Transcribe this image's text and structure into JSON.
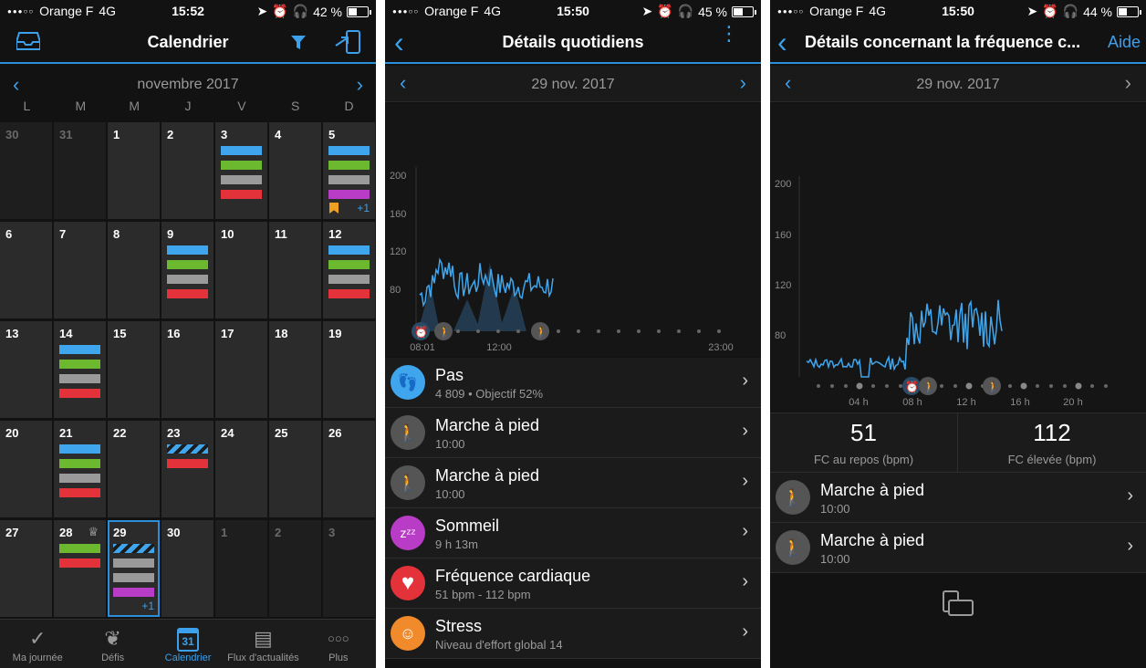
{
  "colors": {
    "blue": "#3fa6ee",
    "green": "#6cb82e",
    "gray": "#9a9a9a",
    "red": "#e4323a",
    "purple": "#b83cc6",
    "accent": "#2a8fd8"
  },
  "screen1": {
    "status": {
      "carrier": "Orange F",
      "network": "4G",
      "time": "15:52",
      "battery": "42 %",
      "battery_level": 0.42
    },
    "nav": {
      "title": "Calendrier",
      "left_icon": "inbox-icon",
      "filter_icon": "filter-icon",
      "export_icon": "export-icon"
    },
    "month": "novembre 2017",
    "weekdays": [
      "L",
      "M",
      "M",
      "J",
      "V",
      "S",
      "D"
    ],
    "days": [
      {
        "n": "30",
        "dim": true,
        "bars": []
      },
      {
        "n": "31",
        "dim": true,
        "bars": []
      },
      {
        "n": "1",
        "bars": []
      },
      {
        "n": "2",
        "bars": []
      },
      {
        "n": "3",
        "bars": [
          "blue",
          "green",
          "gray",
          "red"
        ]
      },
      {
        "n": "4",
        "bars": []
      },
      {
        "n": "5",
        "bars": [
          "blue",
          "green",
          "gray",
          "purple"
        ],
        "flag": true,
        "plus": "+1"
      },
      {
        "n": "6",
        "bars": []
      },
      {
        "n": "7",
        "bars": []
      },
      {
        "n": "8",
        "bars": []
      },
      {
        "n": "9",
        "bars": [
          "blue",
          "green",
          "gray",
          "red"
        ]
      },
      {
        "n": "10",
        "bars": []
      },
      {
        "n": "11",
        "bars": []
      },
      {
        "n": "12",
        "bars": [
          "blue",
          "green",
          "gray",
          "red"
        ]
      },
      {
        "n": "13",
        "bars": []
      },
      {
        "n": "14",
        "bars": [
          "blue",
          "green",
          "gray",
          "red"
        ]
      },
      {
        "n": "15",
        "bars": []
      },
      {
        "n": "16",
        "bars": []
      },
      {
        "n": "17",
        "bars": []
      },
      {
        "n": "18",
        "bars": []
      },
      {
        "n": "19",
        "bars": []
      },
      {
        "n": "20",
        "bars": []
      },
      {
        "n": "21",
        "bars": [
          "blue",
          "green",
          "gray",
          "red"
        ]
      },
      {
        "n": "22",
        "bars": []
      },
      {
        "n": "23",
        "bars": [
          "stripe",
          "red"
        ]
      },
      {
        "n": "24",
        "bars": []
      },
      {
        "n": "25",
        "bars": []
      },
      {
        "n": "26",
        "bars": []
      },
      {
        "n": "27",
        "bars": []
      },
      {
        "n": "28",
        "bars": [
          "green",
          "red"
        ],
        "badge": true
      },
      {
        "n": "29",
        "bars": [
          "stripe",
          "gray",
          "gray",
          "purple"
        ],
        "plus": "+1",
        "sel": true
      },
      {
        "n": "30",
        "bars": []
      },
      {
        "n": "1",
        "dim": true,
        "bars": []
      },
      {
        "n": "2",
        "dim": true,
        "bars": []
      },
      {
        "n": "3",
        "dim": true,
        "bars": []
      }
    ],
    "tabs": [
      {
        "label": "Ma journée",
        "icon": "check-icon"
      },
      {
        "label": "Défis",
        "icon": "laurel-icon"
      },
      {
        "label": "Calendrier",
        "icon": "calendar-icon",
        "cal_num": "31",
        "active": true
      },
      {
        "label": "Flux d'actualités",
        "icon": "news-icon"
      },
      {
        "label": "Plus",
        "icon": "more-icon"
      }
    ]
  },
  "screen2": {
    "status": {
      "carrier": "Orange F",
      "network": "4G",
      "time": "15:50",
      "battery": "45 %",
      "battery_level": 0.45
    },
    "nav": {
      "title": "Détails quotidiens"
    },
    "date": "29 nov. 2017",
    "chart": {
      "yticks": [
        "200",
        "160",
        "120",
        "80"
      ],
      "xticks": [
        "08:01",
        "12:00",
        "23:00"
      ]
    },
    "rows": [
      {
        "title": "Pas",
        "sub": "4 809 • Objectif 52%",
        "icon": "footsteps-icon",
        "color": "#3fa6ee"
      },
      {
        "title": "Marche à pied",
        "sub": "10:00",
        "icon": "walk-icon",
        "color": "#555555"
      },
      {
        "title": "Marche à pied",
        "sub": "10:00",
        "icon": "walk-icon",
        "color": "#555555"
      },
      {
        "title": "Sommeil",
        "sub": "9 h 13m",
        "icon": "sleep-icon",
        "color": "#b83cc6"
      },
      {
        "title": "Fréquence cardiaque",
        "sub": "51 bpm - 112 bpm",
        "icon": "heart-icon",
        "color": "#e4323a"
      },
      {
        "title": "Stress",
        "sub": "Niveau d'effort global 14",
        "icon": "stress-icon",
        "color": "#f08a2a"
      }
    ]
  },
  "screen3": {
    "status": {
      "carrier": "Orange F",
      "network": "4G",
      "time": "15:50",
      "battery": "44 %",
      "battery_level": 0.44
    },
    "nav": {
      "title": "Détails concernant la fréquence c...",
      "help": "Aide"
    },
    "date": "29 nov. 2017",
    "chart": {
      "yticks": [
        "200",
        "160",
        "120",
        "80"
      ],
      "xticks": [
        "04 h",
        "08 h",
        "12 h",
        "16 h",
        "20 h"
      ]
    },
    "stats": [
      {
        "value": "51",
        "label": "FC au repos (bpm)"
      },
      {
        "value": "112",
        "label": "FC élevée (bpm)"
      }
    ],
    "rows": [
      {
        "title": "Marche à pied",
        "sub": "10:00",
        "icon": "walk-icon"
      },
      {
        "title": "Marche à pied",
        "sub": "10:00",
        "icon": "walk-icon"
      }
    ],
    "bottom_icon": "rotate-device-icon"
  }
}
